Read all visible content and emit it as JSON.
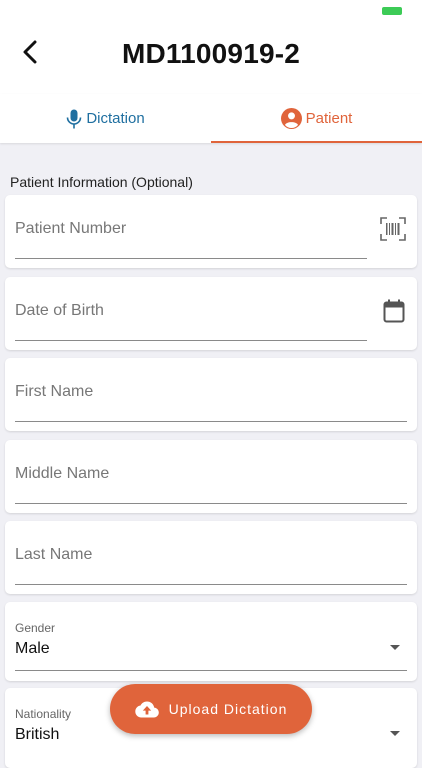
{
  "header": {
    "title": "MD1100919-2"
  },
  "tabs": [
    {
      "label": "Dictation",
      "icon": "microphone-icon"
    },
    {
      "label": "Patient",
      "icon": "account-circle-icon"
    }
  ],
  "section": {
    "label": "Patient Information (Optional)"
  },
  "fields": {
    "patient_number": {
      "placeholder": "Patient Number",
      "icon": "barcode-scan-icon"
    },
    "date_of_birth": {
      "placeholder": "Date of Birth",
      "icon": "calendar-icon"
    },
    "first_name": {
      "placeholder": "First Name"
    },
    "middle_name": {
      "placeholder": "Middle Name"
    },
    "last_name": {
      "placeholder": "Last Name"
    },
    "gender": {
      "label": "Gender",
      "value": "Male"
    },
    "nationality": {
      "label": "Nationality",
      "value": "British"
    }
  },
  "upload_button": {
    "label": "Upload Dictation",
    "icon": "cloud-upload-icon"
  },
  "colors": {
    "accent": "#e0643b",
    "dictation_tab": "#1f6fa0",
    "battery": "#3ccb56"
  }
}
